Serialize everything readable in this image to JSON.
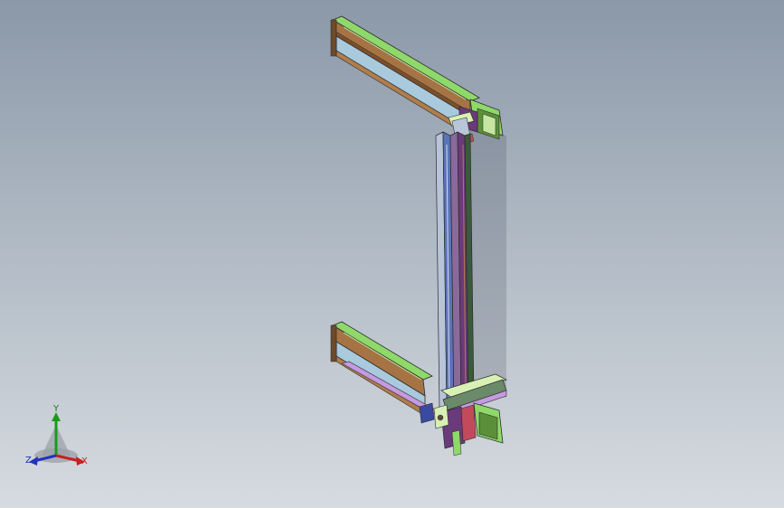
{
  "viewport": {
    "background_top": "#8b98a8",
    "background_bottom": "#d6dbe0"
  },
  "triad": {
    "x_label": "X",
    "y_label": "Y",
    "z_label": "Z",
    "x_color": "#c62020",
    "y_color": "#1a9a1a",
    "z_color": "#2233bb"
  },
  "model": {
    "description_icon": "cad-assembly-frame",
    "colors": {
      "wood": "#9a6a3a",
      "panel": "#a7c7dc",
      "green": "#8fd86a",
      "purple": "#6a3a7a",
      "blue": "#5b74b8",
      "lilac": "#c49ae0",
      "edge": "#2a2a2a"
    }
  }
}
